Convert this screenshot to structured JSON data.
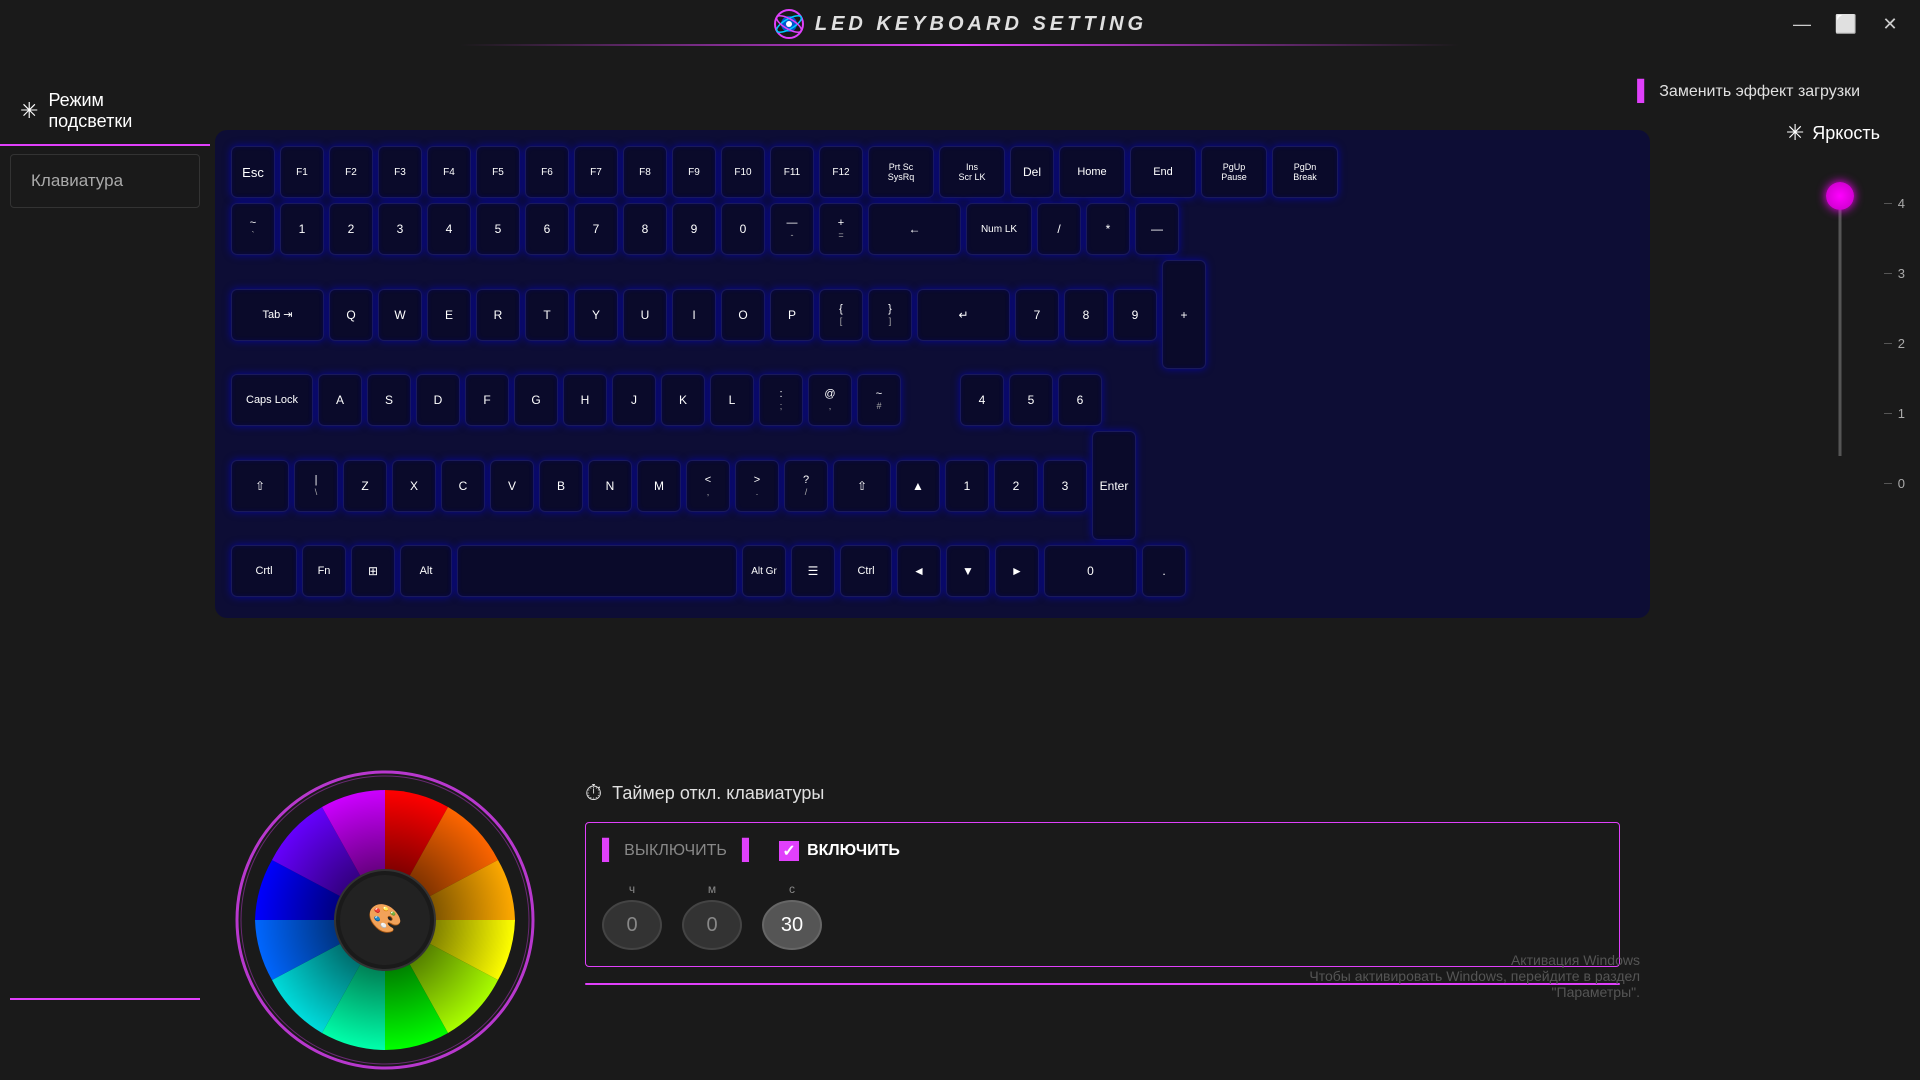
{
  "titleBar": {
    "title": "LED KEYBOARD SETTING",
    "minimizeLabel": "—",
    "maximizeLabel": "⬜",
    "closeLabel": "✕"
  },
  "sidebar": {
    "modeLabel": "Режим подсветки",
    "keyboardLabel": "Клавиатура"
  },
  "header": {
    "replaceEffect": "Заменить эффект загрузки"
  },
  "keyboard": {
    "rows": [
      [
        "Esc",
        "F1",
        "F2",
        "F3",
        "F4",
        "F5",
        "F6",
        "F7",
        "F8",
        "F9",
        "F10",
        "F11",
        "F12",
        "Prt Sc\nSysRq",
        "Ins\nScr LK",
        "Del",
        "Home",
        "End",
        "PgUp\nPause",
        "PgDn\nBreak"
      ],
      [
        "~\n`",
        "1",
        "2",
        "3",
        "4",
        "5",
        "6",
        "7",
        "8",
        "9",
        "0",
        "—\n-",
        "+\n=",
        "←",
        "Num LK",
        "/",
        "*",
        "—"
      ],
      [
        "Tab ⇥",
        "Q",
        "W",
        "E",
        "R",
        "T",
        "Y",
        "U",
        "I",
        "O",
        "P",
        "{\n[",
        "}\n]",
        "↵",
        "7",
        "8",
        "9",
        "+"
      ],
      [
        "Caps Lock",
        "A",
        "S",
        "D",
        "F",
        "G",
        "H",
        "J",
        "K",
        "L",
        ":\n;",
        "@\n,",
        "~\n#",
        "",
        "4",
        "5",
        "6",
        ""
      ],
      [
        "⇧",
        "|\n\\",
        "Z",
        "X",
        "C",
        "V",
        "B",
        "N",
        "M",
        "<\n,",
        ">\n.",
        "?\n/",
        "⇧",
        "▲",
        "1",
        "2",
        "3",
        "Enter"
      ],
      [
        "Crtl",
        "Fn",
        "⊞",
        "Alt",
        "",
        "Alt Gr",
        "☰",
        "Ctrl",
        "◄",
        "▼",
        "►",
        "0",
        ".",
        ""
      ]
    ]
  },
  "brightness": {
    "label": "Яркость",
    "ticks": [
      "4",
      "3",
      "2",
      "1",
      "0"
    ],
    "currentValue": 4
  },
  "colorWheel": {
    "centerIcon": "🎨"
  },
  "timer": {
    "title": "Таймер откл. клавиатуры",
    "offLabel": "ВЫКЛЮЧИТЬ",
    "onLabel": "ВКЛЮЧИТЬ",
    "isOn": true,
    "hoursLabel": "ч",
    "minutesLabel": "м",
    "secondsLabel": "с",
    "hoursValue": "0",
    "minutesValue": "0",
    "secondsValue": "30"
  },
  "windowsWatermark": {
    "line1": "Активация Windows",
    "line2": "Чтобы активировать Windows, перейдите в раздел",
    "line3": "\"Параметры\"."
  }
}
